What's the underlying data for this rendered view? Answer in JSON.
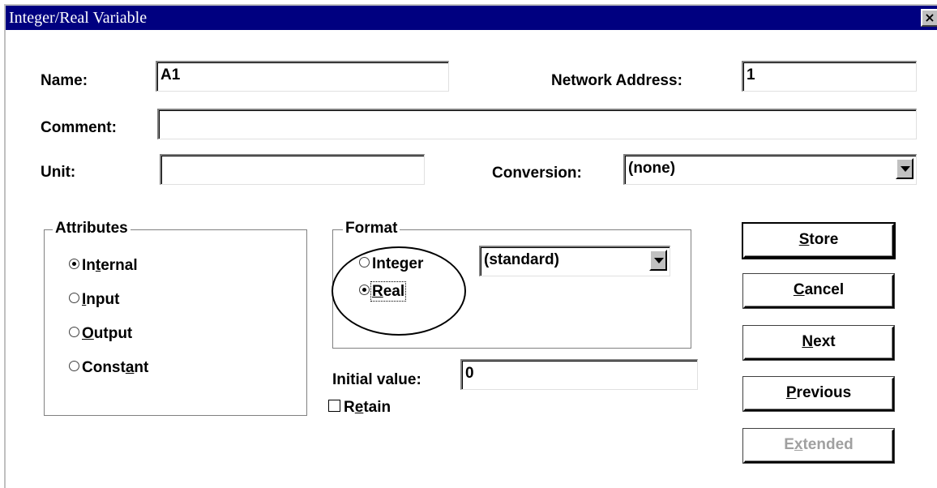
{
  "window": {
    "title": "Integer/Real Variable",
    "close": "×"
  },
  "fields": {
    "name": {
      "label": "Name:",
      "value": "A1"
    },
    "network_address": {
      "label": "Network Address:",
      "value": "1"
    },
    "comment": {
      "label": "Comment:",
      "value": ""
    },
    "unit": {
      "label": "Unit:",
      "value": ""
    },
    "conversion": {
      "label": "Conversion:",
      "value": "(none)"
    },
    "initial_value": {
      "label": "Initial value:",
      "value": "0"
    },
    "retain": {
      "label": "Retain",
      "mnemonic": "e",
      "checked": false
    }
  },
  "attributes": {
    "title": "Attributes",
    "options": [
      {
        "label": "Internal",
        "mnemonic": "t",
        "selected": true
      },
      {
        "label": "Input",
        "mnemonic": "I",
        "selected": false
      },
      {
        "label": "Output",
        "mnemonic": "O",
        "selected": false
      },
      {
        "label": "Constant",
        "mnemonic": "a",
        "selected": false
      }
    ]
  },
  "format": {
    "title": "Format",
    "options": [
      {
        "label": "Integer",
        "mnemonic": "g",
        "selected": false
      },
      {
        "label": "Real",
        "mnemonic": "R",
        "selected": true
      }
    ],
    "style": "(standard)"
  },
  "buttons": [
    {
      "label": "Store",
      "mnemonic": "S",
      "enabled": true,
      "default": true
    },
    {
      "label": "Cancel",
      "mnemonic": "C",
      "enabled": true
    },
    {
      "label": "Next",
      "mnemonic": "N",
      "enabled": true
    },
    {
      "label": "Previous",
      "mnemonic": "P",
      "enabled": true
    },
    {
      "label": "Extended",
      "mnemonic": "x",
      "enabled": false
    }
  ],
  "colors": {
    "titlebar": "#000080",
    "dialog_bg": "#ffffff",
    "disabled_text": "#a0a0a0"
  }
}
